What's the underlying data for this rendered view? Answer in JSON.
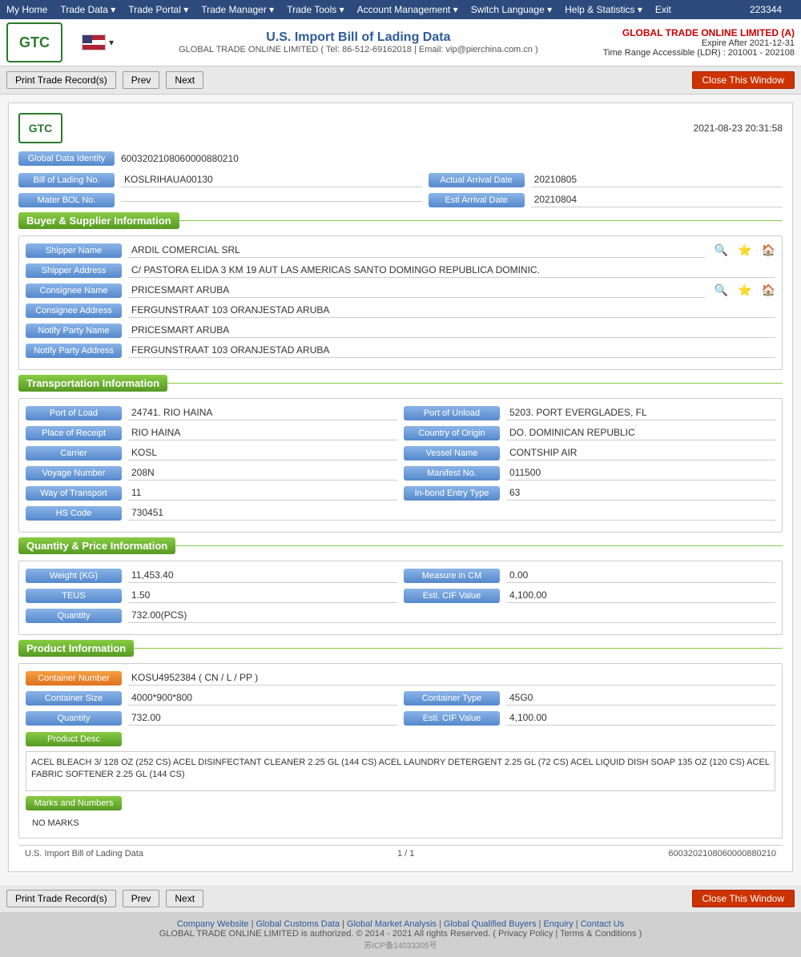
{
  "nav": {
    "items": [
      "My Home",
      "Trade Data",
      "Trade Portal",
      "Trade Manager",
      "Trade Tools",
      "Account Management",
      "Switch Language",
      "Help & Statistics",
      "Exit"
    ],
    "counter": "223344"
  },
  "header": {
    "logo": "GTC",
    "title": "U.S. Import Bill of Lading Data",
    "subtitle": "GLOBAL TRADE ONLINE LIMITED ( Tel: 86-512-69162018 | Email: vip@pierchina.com.cn )",
    "company_name": "GLOBAL TRADE ONLINE LIMITED (A)",
    "expire": "Expire After 2021-12-31",
    "time_range": "Time Range Accessible (LDR) : 201001 - 202108"
  },
  "toolbar": {
    "print_label": "Print Trade Record(s)",
    "prev_label": "Prev",
    "next_label": "Next",
    "close_label": "Close This Window"
  },
  "record": {
    "date": "2021-08-23 20:31:58",
    "global_data_id_label": "Global Data Identity",
    "global_data_id_value": "6003202108060000880210",
    "bill_of_lading_no_label": "Bill of Lading No.",
    "bill_of_lading_no_value": "KOSLRIHAUA00130",
    "actual_arrival_date_label": "Actual Arrival Date",
    "actual_arrival_date_value": "20210805",
    "master_bol_label": "Mater BOL No.",
    "master_bol_value": "",
    "esti_arrival_date_label": "Esti Arrival Date",
    "esti_arrival_date_value": "20210804"
  },
  "buyer_supplier": {
    "section_title": "Buyer & Supplier Information",
    "shipper_name_label": "Shipper Name",
    "shipper_name_value": "ARDIL COMERCIAL SRL",
    "shipper_address_label": "Shipper Address",
    "shipper_address_value": "C/ PASTORA ELIDA 3 KM 19 AUT LAS AMERICAS SANTO DOMINGO REPUBLICA DOMINIC.",
    "consignee_name_label": "Consignee Name",
    "consignee_name_value": "PRICESMART ARUBA",
    "consignee_address_label": "Consignee Address",
    "consignee_address_value": "FERGUNSTRAAT 103 ORANJESTAD ARUBA",
    "notify_party_name_label": "Notify Party Name",
    "notify_party_name_value": "PRICESMART ARUBA",
    "notify_party_address_label": "Notify Party Address",
    "notify_party_address_value": "FERGUNSTRAAT 103 ORANJESTAD ARUBA"
  },
  "transportation": {
    "section_title": "Transportation Information",
    "port_of_load_label": "Port of Load",
    "port_of_load_value": "24741. RIO HAINA",
    "port_of_unload_label": "Port of Unload",
    "port_of_unload_value": "5203. PORT EVERGLADES, FL",
    "place_of_receipt_label": "Place of Receipt",
    "place_of_receipt_value": "RIO HAINA",
    "country_of_origin_label": "Country of Origin",
    "country_of_origin_value": "DO. DOMINICAN REPUBLIC",
    "carrier_label": "Carrier",
    "carrier_value": "KOSL",
    "vessel_name_label": "Vessel Name",
    "vessel_name_value": "CONTSHIP AIR",
    "voyage_number_label": "Voyage Number",
    "voyage_number_value": "208N",
    "manifest_no_label": "Manifest No.",
    "manifest_no_value": "011500",
    "way_of_transport_label": "Way of Transport",
    "way_of_transport_value": "11",
    "in_bond_entry_type_label": "In-bond Entry Type",
    "in_bond_entry_type_value": "63",
    "hs_code_label": "HS Code",
    "hs_code_value": "730451"
  },
  "quantity_price": {
    "section_title": "Quantity & Price Information",
    "weight_kg_label": "Weight (KG)",
    "weight_kg_value": "11,453.40",
    "measure_in_cm_label": "Measure in CM",
    "measure_in_cm_value": "0.00",
    "teus_label": "TEUS",
    "teus_value": "1.50",
    "esti_cif_value_label": "Esti. CIF Value",
    "esti_cif_value_value": "4,100.00",
    "quantity_label": "Quantity",
    "quantity_value": "732.00(PCS)"
  },
  "product": {
    "section_title": "Product Information",
    "container_number_label": "Container Number",
    "container_number_value": "KOSU4952384 ( CN / L / PP )",
    "container_size_label": "Container Size",
    "container_size_value": "4000*900*800",
    "container_type_label": "Container Type",
    "container_type_value": "45G0",
    "quantity_label": "Quantity",
    "quantity_value": "732.00",
    "esti_cif_value_label": "Esti. CIF Value",
    "esti_cif_value_value": "4,100.00",
    "product_desc_label": "Product Desc",
    "product_desc_value": "ACEL BLEACH 3/ 128 OZ (252 CS) ACEL DISINFECTANT CLEANER 2.25 GL (144 CS) ACEL LAUNDRY DETERGENT 2.25 GL (72 CS) ACEL LIQUID DISH SOAP 135 OZ (120 CS) ACEL FABRIC SOFTENER 2.25 GL (144 CS)",
    "marks_and_numbers_label": "Marks and Numbers",
    "marks_and_numbers_value": "NO MARKS"
  },
  "footer_record": {
    "left": "U.S. Import Bill of Lading Data",
    "middle": "1 / 1",
    "right": "6003202108060000880210"
  },
  "page_footer": {
    "links": [
      "Company Website",
      "Global Customs Data",
      "Global Market Analysis",
      "Global Qualified Buyers",
      "Enquiry",
      "Contact Us"
    ],
    "copyright": "GLOBAL TRADE ONLINE LIMITED is authorized. © 2014 - 2021 All rights Reserved.  (  Privacy Policy  |  Terms & Conditions  )",
    "icp": "苏ICP备14033305号"
  }
}
